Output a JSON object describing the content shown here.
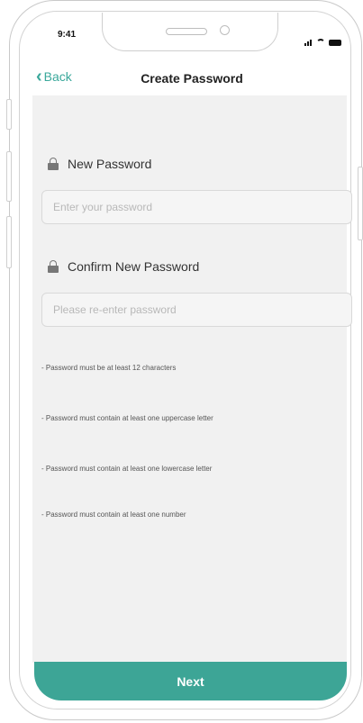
{
  "status_bar": {
    "time": "9:41"
  },
  "nav": {
    "back_label": "Back",
    "title": "Create Password"
  },
  "form": {
    "new_password": {
      "label": "New Password",
      "placeholder": "Enter your password",
      "value": ""
    },
    "confirm_password": {
      "label": "Confirm New Password",
      "placeholder": "Please re-enter password",
      "value": ""
    }
  },
  "rules": [
    "- Password must be at least 12 characters",
    "- Password must contain at least one uppercase letter",
    "- Password must contain at least one lowercase letter",
    "- Password must contain at least one number"
  ],
  "footer": {
    "next_label": "Next"
  },
  "colors": {
    "accent": "#3da596",
    "back_link": "#3aa89b",
    "screen_bg": "#f1f1f1"
  },
  "icons": [
    "chevron-left-icon",
    "lock-icon",
    "signal-icon",
    "wifi-icon",
    "battery-icon"
  ]
}
